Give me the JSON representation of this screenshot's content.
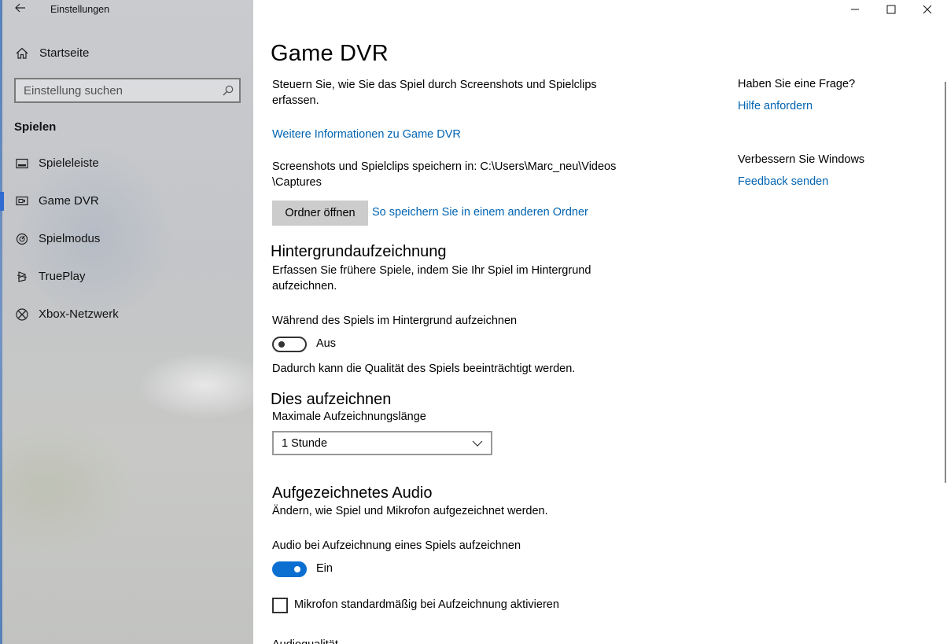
{
  "window": {
    "title": "Einstellungen",
    "controls": [
      "minimize-icon",
      "maximize-icon",
      "close-icon"
    ]
  },
  "sidebar": {
    "home_label": "Startseite",
    "search_placeholder": "Einstellung suchen",
    "group_title": "Spielen",
    "items": [
      {
        "label": "Spieleleiste",
        "icon": "game-bar-icon"
      },
      {
        "label": "Game DVR",
        "icon": "game-dvr-icon",
        "active": true
      },
      {
        "label": "Spielmodus",
        "icon": "game-mode-icon"
      },
      {
        "label": "TruePlay",
        "icon": "trueplay-icon"
      },
      {
        "label": "Xbox-Netzwerk",
        "icon": "xbox-icon"
      }
    ]
  },
  "main": {
    "title": "Game DVR",
    "intro": "Steuern Sie, wie Sie das Spiel durch Screenshots und Spielclips erfassen.",
    "more_info_link": "Weitere Informationen zu Game DVR",
    "save_path_line1": "Screenshots und Spielclips speichern in: C:\\Users\\Marc_neu\\Videos",
    "save_path_line2": "\\Captures",
    "open_folder_button": "Ordner öffnen",
    "other_folder_link": "So speichern Sie in einem anderen Ordner",
    "background": {
      "heading": "Hintergrundaufzeichnung",
      "desc": "Erfassen Sie frühere Spiele, indem Sie Ihr Spiel im Hintergrund aufzeichnen.",
      "toggle_label": "Während des Spiels im Hintergrund aufzeichnen",
      "toggle_state": "Aus",
      "note": "Dadurch kann die Qualität des Spiels beeinträchtigt werden."
    },
    "record": {
      "heading": "Dies aufzeichnen",
      "max_length_label": "Maximale Aufzeichnungslänge",
      "max_length_value": "1 Stunde"
    },
    "audio": {
      "heading": "Aufgezeichnetes Audio",
      "desc": "Ändern, wie Spiel und Mikrofon aufgezeichnet werden.",
      "toggle_label": "Audio bei Aufzeichnung eines Spiels aufzeichnen",
      "toggle_state": "Ein",
      "mic_checkbox_label": "Mikrofon standardmäßig bei Aufzeichnung aktivieren",
      "quality_label_partial": "Audioqualität"
    }
  },
  "aside": {
    "question_heading": "Haben Sie eine Frage?",
    "help_link": "Hilfe anfordern",
    "improve_heading": "Verbessern Sie Windows",
    "feedback_link": "Feedback senden"
  },
  "colors": {
    "accent": "#0063b1",
    "toggle_on": "#0b6fd1",
    "button_bg": "#cccccc"
  }
}
